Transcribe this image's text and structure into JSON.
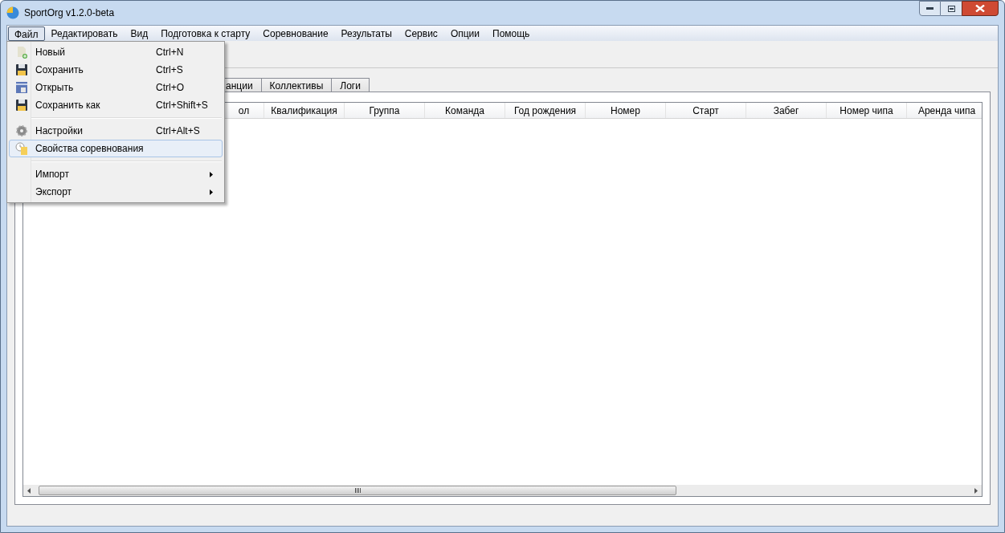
{
  "window": {
    "title": "SportOrg v1.2.0-beta"
  },
  "menu_bar": [
    {
      "label": "Файл",
      "selected": true
    },
    {
      "label": "Редактировать",
      "selected": false
    },
    {
      "label": "Вид",
      "selected": false
    },
    {
      "label": "Подготовка к старту",
      "selected": false
    },
    {
      "label": "Соревнование",
      "selected": false
    },
    {
      "label": "Результаты",
      "selected": false
    },
    {
      "label": "Сервис",
      "selected": false
    },
    {
      "label": "Опции",
      "selected": false
    },
    {
      "label": "Помощь",
      "selected": false
    }
  ],
  "file_menu": [
    {
      "kind": "item",
      "label": "Новый",
      "shortcut": "Ctrl+N",
      "selected": false
    },
    {
      "kind": "item",
      "label": "Сохранить",
      "shortcut": "Ctrl+S",
      "selected": false
    },
    {
      "kind": "item",
      "label": "Открыть",
      "shortcut": "Ctrl+O",
      "selected": false
    },
    {
      "kind": "item",
      "label": "Сохранить как",
      "shortcut": "Ctrl+Shift+S",
      "selected": false
    },
    {
      "kind": "separator"
    },
    {
      "kind": "item",
      "label": "Настройки",
      "shortcut": "Ctrl+Alt+S",
      "selected": false
    },
    {
      "kind": "item",
      "label": "Свойства соревнования",
      "selected": true
    },
    {
      "kind": "separator"
    },
    {
      "kind": "submenu",
      "label": "Импорт",
      "selected": false
    },
    {
      "kind": "submenu",
      "label": "Экспорт",
      "selected": false
    }
  ],
  "tabs": [
    {
      "label": "анции",
      "selected": false
    },
    {
      "label": "Коллективы",
      "selected": false
    },
    {
      "label": "Логи",
      "selected": false
    }
  ],
  "table": {
    "columns": [
      "ол",
      "Квалификация",
      "Группа",
      "Команда",
      "Год рождения",
      "Номер",
      "Старт",
      "Забег",
      "Номер чипа",
      "Аренда чипа"
    ]
  }
}
